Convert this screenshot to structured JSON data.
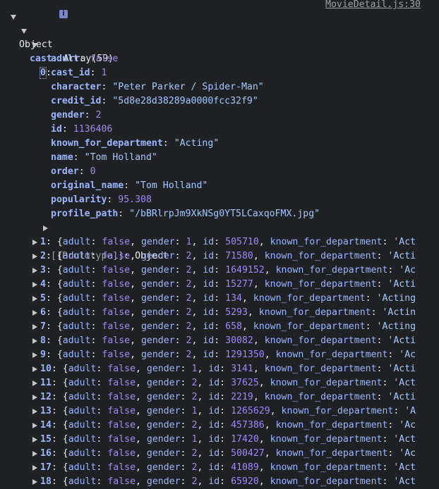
{
  "source_link": "MovieDetail.js:30",
  "root": {
    "label": "Object",
    "info_icon": "i"
  },
  "cast": {
    "key": "cast",
    "value": "Array(59)"
  },
  "item0": {
    "key": "0",
    "props": [
      {
        "key": "adult",
        "value": "false",
        "type": "bool"
      },
      {
        "key": "cast_id",
        "value": "1",
        "type": "num"
      },
      {
        "key": "character",
        "value": "\"Peter Parker / Spider-Man\"",
        "type": "str"
      },
      {
        "key": "credit_id",
        "value": "\"5d8e28d38289a0000fcc32f9\"",
        "type": "str"
      },
      {
        "key": "gender",
        "value": "2",
        "type": "num"
      },
      {
        "key": "id",
        "value": "1136406",
        "type": "num"
      },
      {
        "key": "known_for_department",
        "value": "\"Acting\"",
        "type": "str"
      },
      {
        "key": "name",
        "value": "\"Tom Holland\"",
        "type": "str"
      },
      {
        "key": "order",
        "value": "0",
        "type": "num"
      },
      {
        "key": "original_name",
        "value": "\"Tom Holland\"",
        "type": "str"
      },
      {
        "key": "popularity",
        "value": "95.308",
        "type": "num"
      },
      {
        "key": "profile_path",
        "value": "\"/bBRlrpJm9XkNSg0YT5LCaxqoFMX.jpg\"",
        "type": "str"
      }
    ],
    "prototype": {
      "key": "[[Prototype]]",
      "value": "Object"
    }
  },
  "collapsed_items": [
    {
      "index": "1",
      "gender": "1",
      "id": "505710",
      "dept": "'Act"
    },
    {
      "index": "2",
      "gender": "2",
      "id": "71580",
      "dept": "'Acti"
    },
    {
      "index": "3",
      "gender": "2",
      "id": "1649152",
      "dept": "'Ac"
    },
    {
      "index": "4",
      "gender": "2",
      "id": "15277",
      "dept": "'Acti"
    },
    {
      "index": "5",
      "gender": "2",
      "id": "134",
      "dept": "'Acting"
    },
    {
      "index": "6",
      "gender": "2",
      "id": "5293",
      "dept": "'Actin"
    },
    {
      "index": "7",
      "gender": "2",
      "id": "658",
      "dept": "'Acting"
    },
    {
      "index": "8",
      "gender": "2",
      "id": "30082",
      "dept": "'Acti"
    },
    {
      "index": "9",
      "gender": "2",
      "id": "1291350",
      "dept": "'Ac"
    },
    {
      "index": "10",
      "gender": "1",
      "id": "3141",
      "dept": "'Acti"
    },
    {
      "index": "11",
      "gender": "2",
      "id": "37625",
      "dept": "'Act"
    },
    {
      "index": "12",
      "gender": "2",
      "id": "2219",
      "dept": "'Acti"
    },
    {
      "index": "13",
      "gender": "1",
      "id": "1265629",
      "dept": "'A"
    },
    {
      "index": "14",
      "gender": "2",
      "id": "457386",
      "dept": "'Ac"
    },
    {
      "index": "15",
      "gender": "1",
      "id": "17420",
      "dept": "'Act"
    },
    {
      "index": "16",
      "gender": "2",
      "id": "500427",
      "dept": "'Ac"
    },
    {
      "index": "17",
      "gender": "2",
      "id": "41089",
      "dept": "'Act"
    },
    {
      "index": "18",
      "gender": "2",
      "id": "65920",
      "dept": "'Act"
    }
  ],
  "preview_keys": {
    "adult": "adult",
    "adult_value": "false",
    "gender": "gender",
    "id": "id",
    "dept_key": "known_for_department"
  }
}
